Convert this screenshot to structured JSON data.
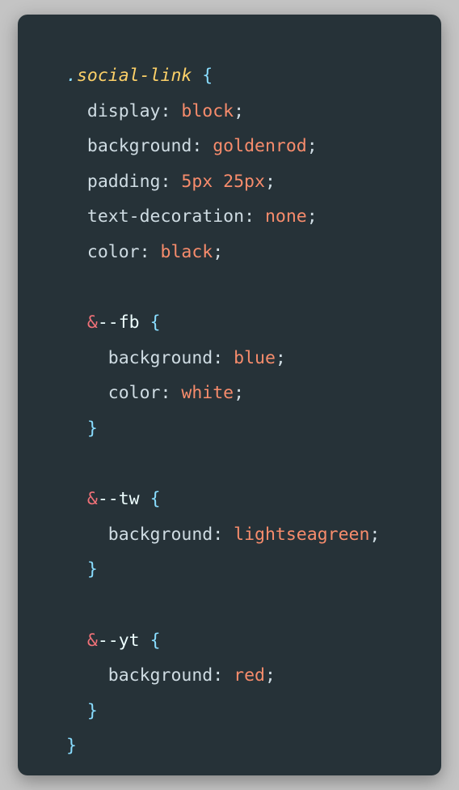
{
  "code": {
    "selector_dot": ".",
    "selector": "social-link",
    "open_brace": "{",
    "close_brace": "}",
    "declarations": [
      {
        "prop": "display",
        "value": "block"
      },
      {
        "prop": "background",
        "value": "goldenrod"
      },
      {
        "prop": "padding",
        "value": "5px 25px"
      },
      {
        "prop": "text-decoration",
        "value": "none"
      },
      {
        "prop": "color",
        "value": "black"
      }
    ],
    "nested": [
      {
        "amp": "&",
        "modifier": "--fb",
        "declarations": [
          {
            "prop": "background",
            "value": "blue"
          },
          {
            "prop": "color",
            "value": "white"
          }
        ]
      },
      {
        "amp": "&",
        "modifier": "--tw",
        "declarations": [
          {
            "prop": "background",
            "value": "lightseagreen"
          }
        ]
      },
      {
        "amp": "&",
        "modifier": "--yt",
        "declarations": [
          {
            "prop": "background",
            "value": "red"
          }
        ]
      }
    ]
  },
  "colors": {
    "page_background": "#c4c4c4",
    "editor_background": "#263238",
    "selector": "#fcd068",
    "brace": "#89ddff",
    "property": "#cfdce3",
    "value": "#f78c6c",
    "ampersand": "#f07178"
  }
}
